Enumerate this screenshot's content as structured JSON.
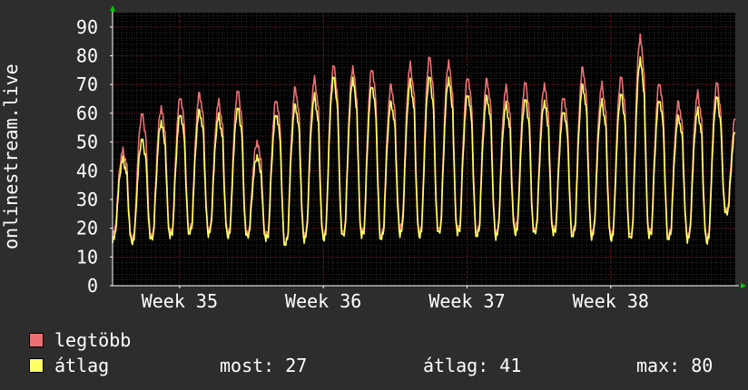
{
  "colors": {
    "background": "#2d2d2d",
    "plot_background": "#000000",
    "grid_major": "#6b1f1f",
    "grid_minor": "#444444",
    "axis": "#ffffff",
    "max_series": "#ec7074",
    "avg_series": "#ffff66",
    "arrow": "#00cc00"
  },
  "legend": {
    "max_label": "legtöbb",
    "avg_label": "átlag",
    "stats": {
      "now_label": "most:",
      "now_value": "27",
      "avg_label": "átlag:",
      "avg_value": "41",
      "max_label": "max:",
      "max_value": "80"
    }
  },
  "chart_data": {
    "type": "line",
    "ylabel": "onlinestream.live",
    "ylim": [
      0,
      95
    ],
    "yticks": [
      0,
      10,
      20,
      30,
      40,
      50,
      60,
      70,
      80,
      90
    ],
    "grid": true,
    "x_range_days": [
      0,
      32.5
    ],
    "xticks": [
      {
        "label": "Week 35",
        "day": 3.5
      },
      {
        "label": "Week 36",
        "day": 11.0
      },
      {
        "label": "Week 37",
        "day": 18.5
      },
      {
        "label": "Week 38",
        "day": 26.0
      }
    ],
    "series": [
      {
        "name": "legtöbb",
        "color": "#ec7074",
        "x": [
          0,
          1,
          2,
          3,
          4,
          5,
          6,
          7,
          8,
          9,
          10,
          11,
          12,
          13,
          14,
          15,
          16,
          17,
          18,
          19,
          20,
          21,
          22,
          23,
          24,
          25,
          26,
          27,
          28,
          29,
          30,
          31,
          32
        ],
        "peaks": [
          47,
          60,
          62,
          66,
          67,
          64,
          68,
          50,
          65,
          69,
          72,
          77,
          76,
          76,
          70,
          77,
          80,
          78,
          73,
          72,
          69,
          71,
          70,
          66,
          76,
          70,
          73,
          87,
          71,
          64,
          67,
          71,
          60
        ],
        "troughs": [
          18,
          16,
          17,
          18,
          19,
          19,
          18,
          18,
          17,
          14,
          17,
          17,
          18,
          18,
          17,
          20,
          18,
          19,
          19,
          18,
          18,
          20,
          19,
          19,
          18,
          18,
          17,
          17,
          18,
          17,
          17,
          16,
          26
        ]
      },
      {
        "name": "átlag",
        "color": "#ffff66",
        "x": [
          0,
          1,
          2,
          3,
          4,
          5,
          6,
          7,
          8,
          9,
          10,
          11,
          12,
          13,
          14,
          15,
          16,
          17,
          18,
          19,
          20,
          21,
          22,
          23,
          24,
          25,
          26,
          27,
          28,
          29,
          30,
          31,
          32
        ],
        "peaks": [
          44,
          51,
          57,
          60,
          61,
          59,
          62,
          45,
          60,
          63,
          66,
          73,
          72,
          70,
          64,
          71,
          73,
          72,
          67,
          66,
          63,
          65,
          64,
          61,
          70,
          64,
          67,
          79,
          65,
          59,
          61,
          66,
          55
        ],
        "troughs": [
          16,
          15,
          16,
          17,
          18,
          18,
          17,
          17,
          16,
          14,
          16,
          16,
          17,
          17,
          16,
          18,
          17,
          18,
          18,
          17,
          17,
          18,
          18,
          18,
          17,
          17,
          16,
          16,
          17,
          16,
          16,
          15,
          25
        ]
      }
    ]
  }
}
